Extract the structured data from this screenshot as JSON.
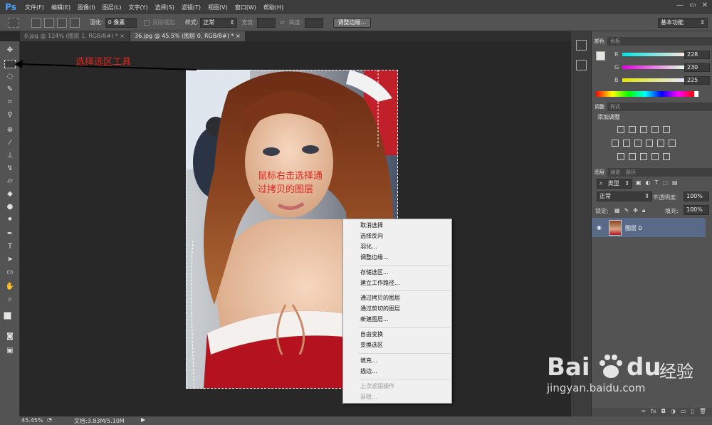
{
  "app": {
    "logo": "Ps",
    "window_controls": [
      "—",
      "▭",
      "✕"
    ]
  },
  "menu": [
    "文件(F)",
    "编辑(E)",
    "图像(I)",
    "图层(L)",
    "文字(Y)",
    "选择(S)",
    "滤镜(T)",
    "视图(V)",
    "窗口(W)",
    "帮助(H)"
  ],
  "options": {
    "feather_label": "羽化:",
    "feather_value": "0 像素",
    "antialias_label": "消除锯齿",
    "style_label": "样式:",
    "style_value": "正常",
    "width_label": "宽度:",
    "height_label": "高度:",
    "refine_button": "调整边缘...",
    "workspace": "基本功能"
  },
  "tabs": [
    "0.jpg @ 124% (图层 1, RGB/8#) *",
    "36.jpg @ 45.5% (图层 0, RGB/8#) *"
  ],
  "status": {
    "zoom": "45.45%",
    "doc": "文档:3.83M/5.10M"
  },
  "color_panel": {
    "tabs": [
      "颜色",
      "色板"
    ],
    "channels": [
      {
        "label": "R",
        "value": "228"
      },
      {
        "label": "G",
        "value": "230"
      },
      {
        "label": "B",
        "value": "225"
      }
    ]
  },
  "adjust_panel": {
    "tabs": [
      "调整",
      "样式"
    ],
    "title": "添加调整"
  },
  "layers_panel": {
    "tabs": [
      "图层",
      "通道",
      "路径"
    ],
    "filter": "类型",
    "blend": "正常",
    "opacity_label": "不透明度:",
    "opacity": "100%",
    "lock_label": "锁定:",
    "fill_label": "填充:",
    "fill": "100%",
    "layer_name": "图层 0"
  },
  "context_menu": {
    "groups": [
      [
        "取消选择",
        "选择反向",
        "羽化...",
        "调整边缘..."
      ],
      [
        "存储选区...",
        "建立工作路径..."
      ],
      [
        "通过拷贝的图层",
        "通过剪切的图层",
        "新建图层..."
      ],
      [
        "自由变换",
        "变换选区"
      ],
      [
        "填充...",
        "描边..."
      ]
    ],
    "disabled": [
      "上次滤镜操作",
      "渐隐..."
    ]
  },
  "annotations": {
    "tool_note": "选择选区工具",
    "rightclick_line1": "鼠标右击选择通",
    "rightclick_line2": "过拷贝的图层"
  },
  "watermark": {
    "brand": "Bai",
    "brand2": "du",
    "cn": "经验",
    "url": "jingyan.baidu.com"
  }
}
